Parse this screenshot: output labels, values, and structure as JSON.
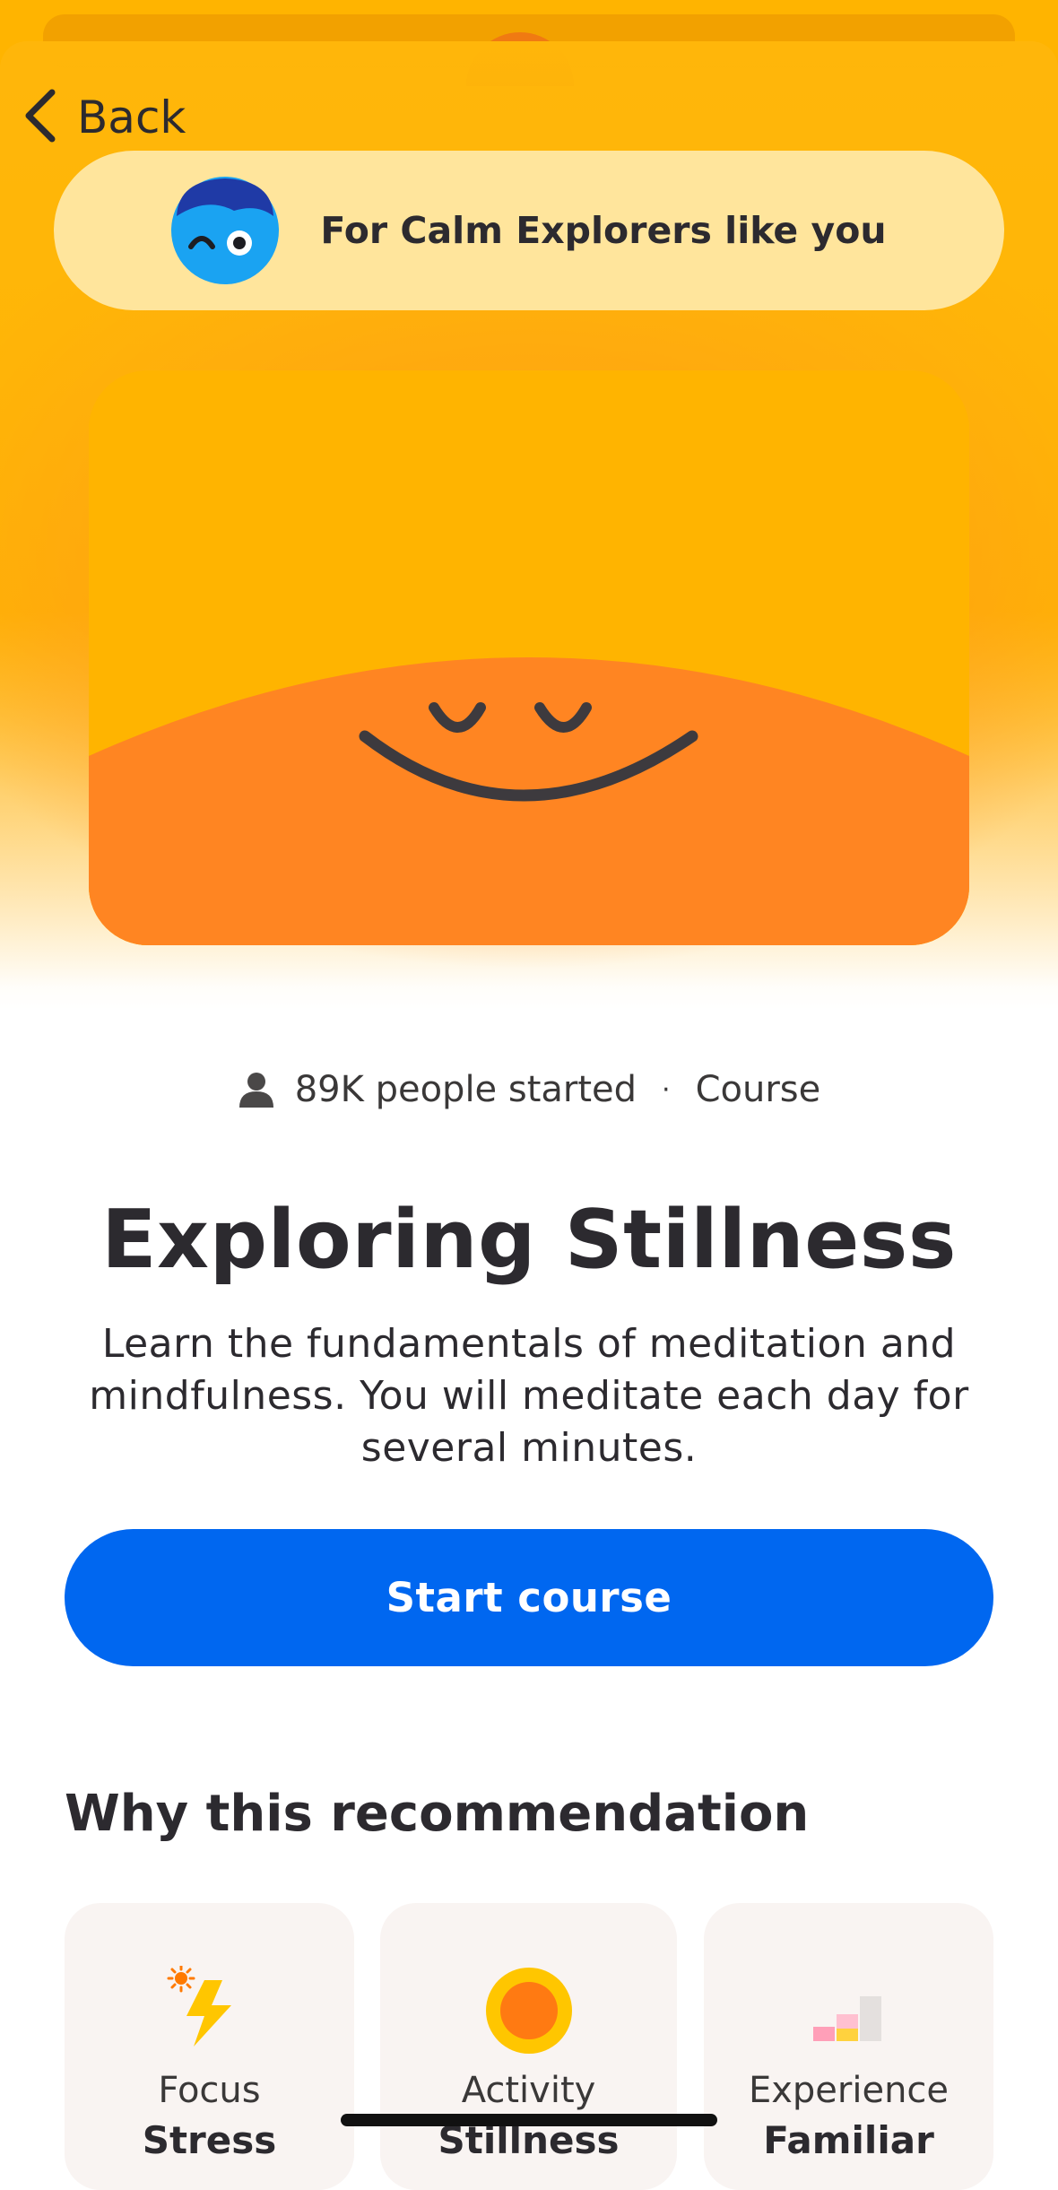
{
  "nav": {
    "back_label": "Back"
  },
  "badge": {
    "text": "For Calm Explorers like you",
    "avatar_icon": "calm-explorer-avatar-icon"
  },
  "hero": {
    "image": "smiling-sun-illustration",
    "colors": {
      "sky": "#ffb400",
      "sun": "#ff8522",
      "face": "#3d3a3e"
    }
  },
  "meta": {
    "started": "89K people started",
    "separator": "·",
    "type": "Course"
  },
  "course": {
    "title": "Exploring Stillness",
    "description": "Learn the fundamentals of meditation and mindfulness. You will meditate each day for several minutes."
  },
  "cta": {
    "label": "Start course",
    "color": "#0067f0"
  },
  "recommendation": {
    "title": "Why this recommendation",
    "cards": [
      {
        "label": "Focus",
        "value": "Stress",
        "icon": "lightning-bolt-icon"
      },
      {
        "label": "Activity",
        "value": "Stillness",
        "icon": "sun-circle-icon"
      },
      {
        "label": "Experience",
        "value": "Familiar",
        "icon": "signal-bars-icon"
      }
    ]
  }
}
